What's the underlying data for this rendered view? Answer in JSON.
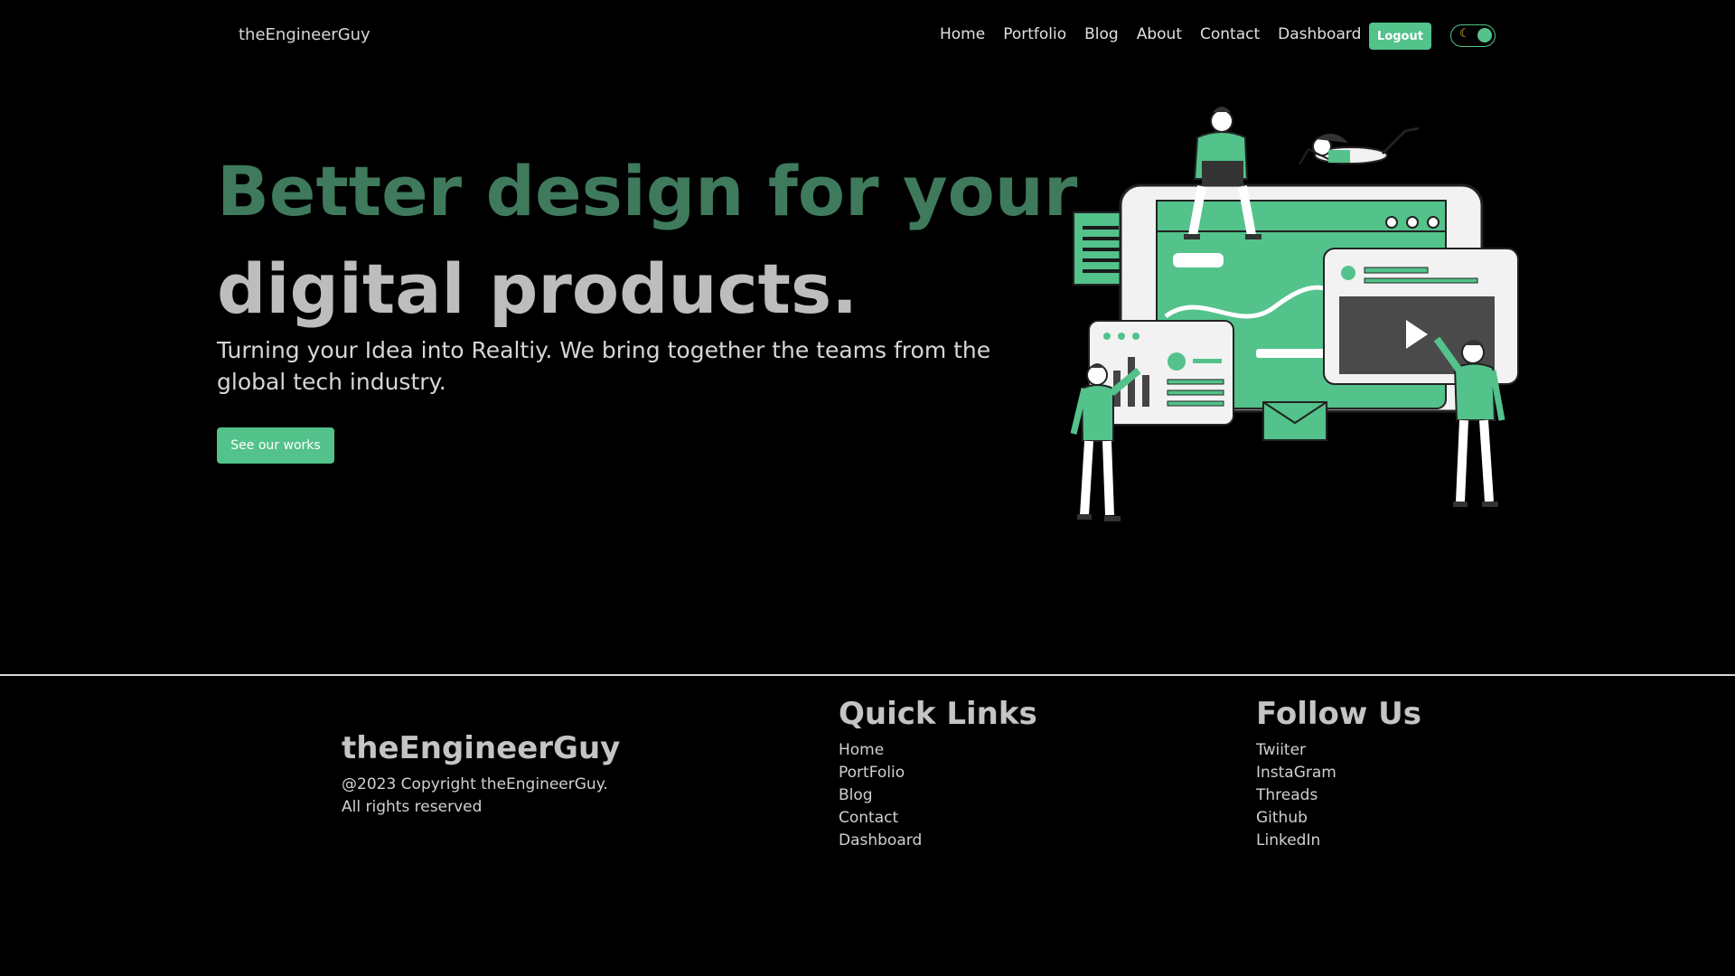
{
  "nav": {
    "brand": "theEngineerGuy",
    "links": [
      "Home",
      "Portfolio",
      "Blog",
      "About",
      "Contact",
      "Dashboard"
    ],
    "logout_label": "Logout",
    "theme_toggle": {
      "icon": "moon-icon",
      "state": "dark"
    }
  },
  "hero": {
    "title_line1": "Better design for your",
    "title_line2": "digital products.",
    "description": "Turning your Idea into Realtiy. We bring together the teams from the global tech industry.",
    "cta_label": "See our works"
  },
  "footer": {
    "brand": "theEngineerGuy",
    "copyright_line1": "@2023 Copyright theEngineerGuy.",
    "copyright_line2": "All rights reserved",
    "quick_links": {
      "title": "Quick Links",
      "items": [
        "Home",
        "PortFolio",
        "Blog",
        "Contact",
        "Dashboard"
      ]
    },
    "follow_us": {
      "title": "Follow Us",
      "items": [
        "Twiiter",
        "InstaGram",
        "Threads",
        "Github",
        "LinkedIn"
      ]
    }
  },
  "colors": {
    "accent": "#53c28b",
    "title_green": "#3f7a5d",
    "title_gray": "#bdbdbd",
    "background": "#000000"
  }
}
